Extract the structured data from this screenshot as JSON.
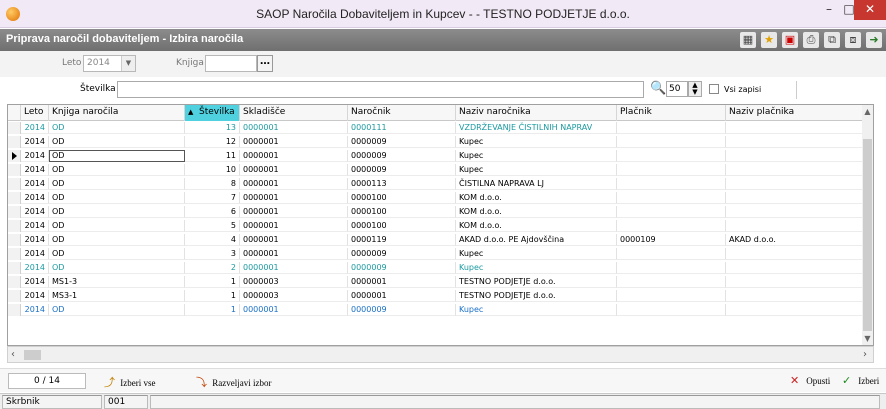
{
  "window": {
    "title": "SAOP Naročila Dobaviteljem in Kupcev -  - TESTNO PODJETJE d.o.o.",
    "min_glyph": "–",
    "max_glyph": "□",
    "close_glyph": "✕"
  },
  "header": {
    "title": "Priprava naročil dobaviteljem - Izbira naročila",
    "toolbar_icons": [
      "grid-icon",
      "star-icon",
      "pdf-icon",
      "print-icon",
      "copy-icon",
      "paste-icon",
      "exit-icon"
    ]
  },
  "filters": {
    "year_label": "Leto",
    "year_value": "2014",
    "book_label": "Knjiga",
    "book_value": "",
    "ellipsis": "…"
  },
  "search": {
    "label": "Številka",
    "value": "",
    "count": "50",
    "all_records_label": "Vsi zapisi"
  },
  "grid": {
    "columns": [
      "Leto",
      "Knjiga naročila",
      "Številka",
      "Skladišče",
      "Naročnik",
      "Naziv naročnika",
      "Plačnik",
      "Naziv plačnika"
    ],
    "sorted_column": 2,
    "rows": [
      {
        "leto": "2014",
        "knjiga": "OD",
        "stevilka": "13",
        "skladisce": "0000001",
        "narocnik": "0000111",
        "naziv": "VZDRŽEVANJE ČISTILNIH NAPRAV",
        "placnik": "",
        "naziv_placnika": "",
        "style": "teal"
      },
      {
        "leto": "2014",
        "knjiga": "OD",
        "stevilka": "12",
        "skladisce": "0000001",
        "narocnik": "0000009",
        "naziv": "Kupec",
        "placnik": "",
        "naziv_placnika": "",
        "style": ""
      },
      {
        "leto": "2014",
        "knjiga": "OD",
        "stevilka": "11",
        "skladisce": "0000001",
        "narocnik": "0000009",
        "naziv": "Kupec",
        "placnik": "",
        "naziv_placnika": "",
        "style": "",
        "current": true
      },
      {
        "leto": "2014",
        "knjiga": "OD",
        "stevilka": "10",
        "skladisce": "0000001",
        "narocnik": "0000009",
        "naziv": "Kupec",
        "placnik": "",
        "naziv_placnika": "",
        "style": ""
      },
      {
        "leto": "2014",
        "knjiga": "OD",
        "stevilka": "8",
        "skladisce": "0000001",
        "narocnik": "0000113",
        "naziv": "ČISTILNA NAPRAVA LJ",
        "placnik": "",
        "naziv_placnika": "",
        "style": ""
      },
      {
        "leto": "2014",
        "knjiga": "OD",
        "stevilka": "7",
        "skladisce": "0000001",
        "narocnik": "0000100",
        "naziv": "KOM d.o.o.",
        "placnik": "",
        "naziv_placnika": "",
        "style": ""
      },
      {
        "leto": "2014",
        "knjiga": "OD",
        "stevilka": "6",
        "skladisce": "0000001",
        "narocnik": "0000100",
        "naziv": "KOM d.o.o.",
        "placnik": "",
        "naziv_placnika": "",
        "style": ""
      },
      {
        "leto": "2014",
        "knjiga": "OD",
        "stevilka": "5",
        "skladisce": "0000001",
        "narocnik": "0000100",
        "naziv": "KOM d.o.o.",
        "placnik": "",
        "naziv_placnika": "",
        "style": ""
      },
      {
        "leto": "2014",
        "knjiga": "OD",
        "stevilka": "4",
        "skladisce": "0000001",
        "narocnik": "0000119",
        "naziv": "AKAD d.o.o. PE Ajdovščina",
        "placnik": "0000109",
        "naziv_placnika": "AKAD d.o.o.",
        "style": ""
      },
      {
        "leto": "2014",
        "knjiga": "OD",
        "stevilka": "3",
        "skladisce": "0000001",
        "narocnik": "0000009",
        "naziv": "Kupec",
        "placnik": "",
        "naziv_placnika": "",
        "style": ""
      },
      {
        "leto": "2014",
        "knjiga": "OD",
        "stevilka": "2",
        "skladisce": "0000001",
        "narocnik": "0000009",
        "naziv": "Kupec",
        "placnik": "",
        "naziv_placnika": "",
        "style": "teal"
      },
      {
        "leto": "2014",
        "knjiga": "MS1-3",
        "stevilka": "1",
        "skladisce": "0000003",
        "narocnik": "0000001",
        "naziv": "TESTNO PODJETJE d.o.o.",
        "placnik": "",
        "naziv_placnika": "",
        "style": ""
      },
      {
        "leto": "2014",
        "knjiga": "MS3-1",
        "stevilka": "1",
        "skladisce": "0000003",
        "narocnik": "0000001",
        "naziv": "TESTNO PODJETJE d.o.o.",
        "placnik": "",
        "naziv_placnika": "",
        "style": ""
      },
      {
        "leto": "2014",
        "knjiga": "OD",
        "stevilka": "1",
        "skladisce": "0000001",
        "narocnik": "0000009",
        "naziv": "Kupec",
        "placnik": "",
        "naziv_placnika": "",
        "style": "blue"
      }
    ]
  },
  "bottom": {
    "counter": "0 / 14",
    "select_all": "Izberi vse",
    "deselect": "Razveljavi izbor",
    "cancel": "Opusti",
    "confirm": "Izberi"
  },
  "status": {
    "user": "Skrbnik",
    "code": "001"
  },
  "colors": {
    "sorted_header": "#4fd1e0",
    "teal_row": "#1a9aa0",
    "blue_row": "#1a70c8",
    "title_bg": "#f2e9f6",
    "header_bg": "#7f7f7f"
  }
}
